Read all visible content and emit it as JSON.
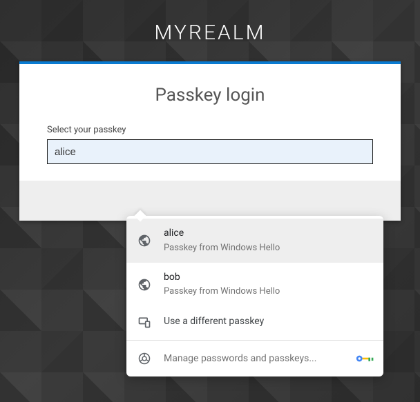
{
  "header": {
    "title": "MYREALM"
  },
  "card": {
    "title": "Passkey login",
    "field_label": "Select your passkey",
    "input_value": "alice"
  },
  "dropdown": {
    "items": [
      {
        "title": "alice",
        "subtitle": "Passkey from Windows Hello"
      },
      {
        "title": "bob",
        "subtitle": "Passkey from Windows Hello"
      }
    ],
    "different_label": "Use a different passkey",
    "manage_label": "Manage passwords and passkeys..."
  }
}
